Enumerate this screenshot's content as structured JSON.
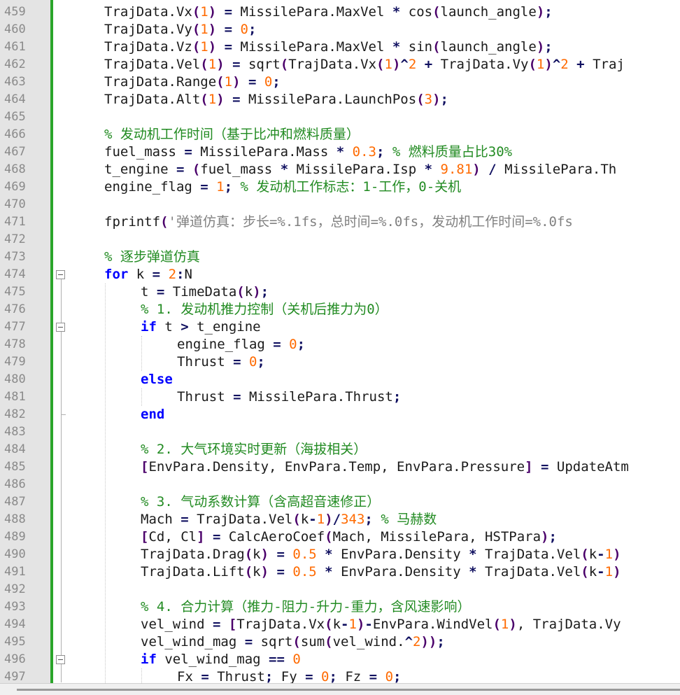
{
  "colors": {
    "keyword": "#0000ff",
    "comment": "#228b22",
    "number": "#ff6a00",
    "string": "#808080",
    "change_bar": "#2aa52a"
  },
  "lines": [
    {
      "n": "459",
      "indent": 0,
      "t": [
        [
          "TrajData.Vx",
          "fn"
        ],
        [
          "(",
          "br"
        ],
        [
          "1",
          "num"
        ],
        [
          ")",
          "br"
        ],
        [
          " = ",
          "op"
        ],
        [
          "MissilePara.MaxVel ",
          "fn"
        ],
        [
          "*",
          "op"
        ],
        [
          " cos",
          "fn"
        ],
        [
          "(",
          "br"
        ],
        [
          "launch_angle",
          "fn"
        ],
        [
          ")",
          "br"
        ],
        [
          ";",
          "op"
        ]
      ]
    },
    {
      "n": "460",
      "indent": 0,
      "t": [
        [
          "TrajData.Vy",
          "fn"
        ],
        [
          "(",
          "br"
        ],
        [
          "1",
          "num"
        ],
        [
          ")",
          "br"
        ],
        [
          " = ",
          "op"
        ],
        [
          "0",
          "num"
        ],
        [
          ";",
          "op"
        ]
      ]
    },
    {
      "n": "461",
      "indent": 0,
      "t": [
        [
          "TrajData.Vz",
          "fn"
        ],
        [
          "(",
          "br"
        ],
        [
          "1",
          "num"
        ],
        [
          ")",
          "br"
        ],
        [
          " = ",
          "op"
        ],
        [
          "MissilePara.MaxVel ",
          "fn"
        ],
        [
          "*",
          "op"
        ],
        [
          " sin",
          "fn"
        ],
        [
          "(",
          "br"
        ],
        [
          "launch_angle",
          "fn"
        ],
        [
          ")",
          "br"
        ],
        [
          ";",
          "op"
        ]
      ]
    },
    {
      "n": "462",
      "indent": 0,
      "t": [
        [
          "TrajData.Vel",
          "fn"
        ],
        [
          "(",
          "br"
        ],
        [
          "1",
          "num"
        ],
        [
          ")",
          "br"
        ],
        [
          " = ",
          "op"
        ],
        [
          "sqrt",
          "fn"
        ],
        [
          "(",
          "br"
        ],
        [
          "TrajData.Vx",
          "fn"
        ],
        [
          "(",
          "br"
        ],
        [
          "1",
          "num"
        ],
        [
          ")",
          "br"
        ],
        [
          "^",
          "op"
        ],
        [
          "2",
          "num"
        ],
        [
          " + ",
          "op"
        ],
        [
          "TrajData.Vy",
          "fn"
        ],
        [
          "(",
          "br"
        ],
        [
          "1",
          "num"
        ],
        [
          ")",
          "br"
        ],
        [
          "^",
          "op"
        ],
        [
          "2",
          "num"
        ],
        [
          " + ",
          "op"
        ],
        [
          "Traj",
          "fn"
        ]
      ]
    },
    {
      "n": "463",
      "indent": 0,
      "t": [
        [
          "TrajData.Range",
          "fn"
        ],
        [
          "(",
          "br"
        ],
        [
          "1",
          "num"
        ],
        [
          ")",
          "br"
        ],
        [
          " = ",
          "op"
        ],
        [
          "0",
          "num"
        ],
        [
          ";",
          "op"
        ]
      ]
    },
    {
      "n": "464",
      "indent": 0,
      "t": [
        [
          "TrajData.Alt",
          "fn"
        ],
        [
          "(",
          "br"
        ],
        [
          "1",
          "num"
        ],
        [
          ")",
          "br"
        ],
        [
          " = ",
          "op"
        ],
        [
          "MissilePara.LaunchPos",
          "fn"
        ],
        [
          "(",
          "br"
        ],
        [
          "3",
          "num"
        ],
        [
          ")",
          "br"
        ],
        [
          ";",
          "op"
        ]
      ]
    },
    {
      "n": "465",
      "indent": 0,
      "t": []
    },
    {
      "n": "466",
      "indent": 0,
      "t": [
        [
          "% 发动机工作时间（基于比冲和燃料质量）",
          "cm"
        ]
      ]
    },
    {
      "n": "467",
      "indent": 0,
      "t": [
        [
          "fuel_mass",
          "fn"
        ],
        [
          " = ",
          "op"
        ],
        [
          "MissilePara.Mass ",
          "fn"
        ],
        [
          "*",
          "op"
        ],
        [
          " ",
          "fn"
        ],
        [
          "0.3",
          "num"
        ],
        [
          ";",
          "op"
        ],
        [
          " % 燃料质量占比30%",
          "cm"
        ]
      ]
    },
    {
      "n": "468",
      "indent": 0,
      "t": [
        [
          "t_engine",
          "fn"
        ],
        [
          " = ",
          "op"
        ],
        [
          "(",
          "br"
        ],
        [
          "fuel_mass ",
          "fn"
        ],
        [
          "*",
          "op"
        ],
        [
          " MissilePara.Isp ",
          "fn"
        ],
        [
          "*",
          "op"
        ],
        [
          " ",
          "fn"
        ],
        [
          "9.81",
          "num"
        ],
        [
          ")",
          "br"
        ],
        [
          " / ",
          "op"
        ],
        [
          "MissilePara.Th",
          "fn"
        ]
      ]
    },
    {
      "n": "469",
      "indent": 0,
      "t": [
        [
          "engine_flag",
          "fn"
        ],
        [
          " = ",
          "op"
        ],
        [
          "1",
          "num"
        ],
        [
          ";",
          "op"
        ],
        [
          " % 发动机工作标志：1-工作，0-关机",
          "cm"
        ]
      ]
    },
    {
      "n": "470",
      "indent": 0,
      "t": []
    },
    {
      "n": "471",
      "indent": 0,
      "t": [
        [
          "fprintf",
          "fn"
        ],
        [
          "(",
          "br"
        ],
        [
          "'弹道仿真：步长=%.1fs，总时间=%.0fs，发动机工作时间=%.0fs",
          "str"
        ]
      ]
    },
    {
      "n": "472",
      "indent": 0,
      "t": []
    },
    {
      "n": "473",
      "indent": 0,
      "t": [
        [
          "% 逐步弹道仿真",
          "cm"
        ]
      ]
    },
    {
      "n": "474",
      "indent": 0,
      "t": [
        [
          "for",
          "kw"
        ],
        [
          " k ",
          "fn"
        ],
        [
          "=",
          "op"
        ],
        [
          " ",
          "fn"
        ],
        [
          "2",
          "num"
        ],
        [
          ":",
          "op"
        ],
        [
          "N",
          "fn"
        ]
      ]
    },
    {
      "n": "475",
      "indent": 1,
      "t": [
        [
          "t",
          "fn"
        ],
        [
          " = ",
          "op"
        ],
        [
          "TimeData",
          "fn"
        ],
        [
          "(",
          "br"
        ],
        [
          "k",
          "fn"
        ],
        [
          ")",
          "br"
        ],
        [
          ";",
          "op"
        ]
      ]
    },
    {
      "n": "476",
      "indent": 1,
      "t": [
        [
          "% 1. 发动机推力控制（关机后推力为0）",
          "cm"
        ]
      ]
    },
    {
      "n": "477",
      "indent": 1,
      "t": [
        [
          "if",
          "kw"
        ],
        [
          " t ",
          "fn"
        ],
        [
          ">",
          "op"
        ],
        [
          " t_engine",
          "fn"
        ]
      ]
    },
    {
      "n": "478",
      "indent": 2,
      "t": [
        [
          "engine_flag",
          "fn"
        ],
        [
          " = ",
          "op"
        ],
        [
          "0",
          "num"
        ],
        [
          ";",
          "op"
        ]
      ]
    },
    {
      "n": "479",
      "indent": 2,
      "t": [
        [
          "Thrust",
          "fn"
        ],
        [
          " = ",
          "op"
        ],
        [
          "0",
          "num"
        ],
        [
          ";",
          "op"
        ]
      ]
    },
    {
      "n": "480",
      "indent": 1,
      "t": [
        [
          "else",
          "kw"
        ]
      ]
    },
    {
      "n": "481",
      "indent": 2,
      "t": [
        [
          "Thrust",
          "fn"
        ],
        [
          " = ",
          "op"
        ],
        [
          "MissilePara.Thrust",
          "fn"
        ],
        [
          ";",
          "op"
        ]
      ]
    },
    {
      "n": "482",
      "indent": 1,
      "t": [
        [
          "end",
          "kw"
        ]
      ]
    },
    {
      "n": "483",
      "indent": 1,
      "t": []
    },
    {
      "n": "484",
      "indent": 1,
      "t": [
        [
          "% 2. 大气环境实时更新（海拔相关）",
          "cm"
        ]
      ]
    },
    {
      "n": "485",
      "indent": 1,
      "t": [
        [
          "[",
          "br"
        ],
        [
          "EnvPara.Density, EnvPara.Temp, EnvPara.Pressure",
          "fn"
        ],
        [
          "]",
          "br"
        ],
        [
          " = ",
          "op"
        ],
        [
          "UpdateAtm",
          "fn"
        ]
      ]
    },
    {
      "n": "486",
      "indent": 1,
      "t": []
    },
    {
      "n": "487",
      "indent": 1,
      "t": [
        [
          "% 3. 气动系数计算（含高超音速修正）",
          "cm"
        ]
      ]
    },
    {
      "n": "488",
      "indent": 1,
      "t": [
        [
          "Mach",
          "fn"
        ],
        [
          " = ",
          "op"
        ],
        [
          "TrajData.Vel",
          "fn"
        ],
        [
          "(",
          "br"
        ],
        [
          "k",
          "fn"
        ],
        [
          "-",
          "op"
        ],
        [
          "1",
          "num"
        ],
        [
          ")",
          "br"
        ],
        [
          "/",
          "op"
        ],
        [
          "343",
          "num"
        ],
        [
          ";",
          "op"
        ],
        [
          " % 马赫数",
          "cm"
        ]
      ]
    },
    {
      "n": "489",
      "indent": 1,
      "t": [
        [
          "[",
          "br"
        ],
        [
          "Cd, Cl",
          "fn"
        ],
        [
          "]",
          "br"
        ],
        [
          " = ",
          "op"
        ],
        [
          "CalcAeroCoef",
          "fn"
        ],
        [
          "(",
          "br"
        ],
        [
          "Mach, MissilePara, HSTPara",
          "fn"
        ],
        [
          ")",
          "br"
        ],
        [
          ";",
          "op"
        ]
      ]
    },
    {
      "n": "490",
      "indent": 1,
      "t": [
        [
          "TrajData.Drag",
          "fn"
        ],
        [
          "(",
          "br"
        ],
        [
          "k",
          "fn"
        ],
        [
          ")",
          "br"
        ],
        [
          " = ",
          "op"
        ],
        [
          "0.5",
          "num"
        ],
        [
          " * ",
          "op"
        ],
        [
          "EnvPara.Density ",
          "fn"
        ],
        [
          "*",
          "op"
        ],
        [
          " TrajData.Vel",
          "fn"
        ],
        [
          "(",
          "br"
        ],
        [
          "k",
          "fn"
        ],
        [
          "-",
          "op"
        ],
        [
          "1",
          "num"
        ],
        [
          ")",
          "br"
        ]
      ]
    },
    {
      "n": "491",
      "indent": 1,
      "t": [
        [
          "TrajData.Lift",
          "fn"
        ],
        [
          "(",
          "br"
        ],
        [
          "k",
          "fn"
        ],
        [
          ")",
          "br"
        ],
        [
          " = ",
          "op"
        ],
        [
          "0.5",
          "num"
        ],
        [
          " * ",
          "op"
        ],
        [
          "EnvPara.Density ",
          "fn"
        ],
        [
          "*",
          "op"
        ],
        [
          " TrajData.Vel",
          "fn"
        ],
        [
          "(",
          "br"
        ],
        [
          "k",
          "fn"
        ],
        [
          "-",
          "op"
        ],
        [
          "1",
          "num"
        ],
        [
          ")",
          "br"
        ]
      ]
    },
    {
      "n": "492",
      "indent": 1,
      "t": []
    },
    {
      "n": "493",
      "indent": 1,
      "t": [
        [
          "% 4. 合力计算（推力-阻力-升力-重力，含风速影响）",
          "cm"
        ]
      ]
    },
    {
      "n": "494",
      "indent": 1,
      "t": [
        [
          "vel_wind",
          "fn"
        ],
        [
          " = ",
          "op"
        ],
        [
          "[",
          "br"
        ],
        [
          "TrajData.Vx",
          "fn"
        ],
        [
          "(",
          "br"
        ],
        [
          "k",
          "fn"
        ],
        [
          "-",
          "op"
        ],
        [
          "1",
          "num"
        ],
        [
          ")",
          "br"
        ],
        [
          "-",
          "op"
        ],
        [
          "EnvPara.WindVel",
          "fn"
        ],
        [
          "(",
          "br"
        ],
        [
          "1",
          "num"
        ],
        [
          ")",
          "br"
        ],
        [
          ", TrajData.Vy",
          "fn"
        ]
      ]
    },
    {
      "n": "495",
      "indent": 1,
      "t": [
        [
          "vel_wind_mag",
          "fn"
        ],
        [
          " = ",
          "op"
        ],
        [
          "sqrt",
          "fn"
        ],
        [
          "(",
          "br"
        ],
        [
          "sum",
          "fn"
        ],
        [
          "(",
          "br"
        ],
        [
          "vel_wind.",
          "fn"
        ],
        [
          "^",
          "op"
        ],
        [
          "2",
          "num"
        ],
        [
          ")",
          "br"
        ],
        [
          ")",
          "br"
        ],
        [
          ";",
          "op"
        ]
      ]
    },
    {
      "n": "496",
      "indent": 1,
      "t": [
        [
          "if",
          "kw"
        ],
        [
          " vel_wind_mag ",
          "fn"
        ],
        [
          "==",
          "op"
        ],
        [
          " ",
          "fn"
        ],
        [
          "0",
          "num"
        ]
      ]
    },
    {
      "n": "497",
      "indent": 2,
      "t": [
        [
          "Fx",
          "fn"
        ],
        [
          " = ",
          "op"
        ],
        [
          "Thrust",
          "fn"
        ],
        [
          ";",
          "op"
        ],
        [
          " Fy ",
          "fn"
        ],
        [
          "=",
          "op"
        ],
        [
          " ",
          "fn"
        ],
        [
          "0",
          "num"
        ],
        [
          ";",
          "op"
        ],
        [
          " Fz ",
          "fn"
        ],
        [
          "=",
          "op"
        ],
        [
          " ",
          "fn"
        ],
        [
          "0",
          "num"
        ],
        [
          ";",
          "op"
        ]
      ]
    }
  ],
  "folds": [
    "474",
    "477",
    "496"
  ]
}
